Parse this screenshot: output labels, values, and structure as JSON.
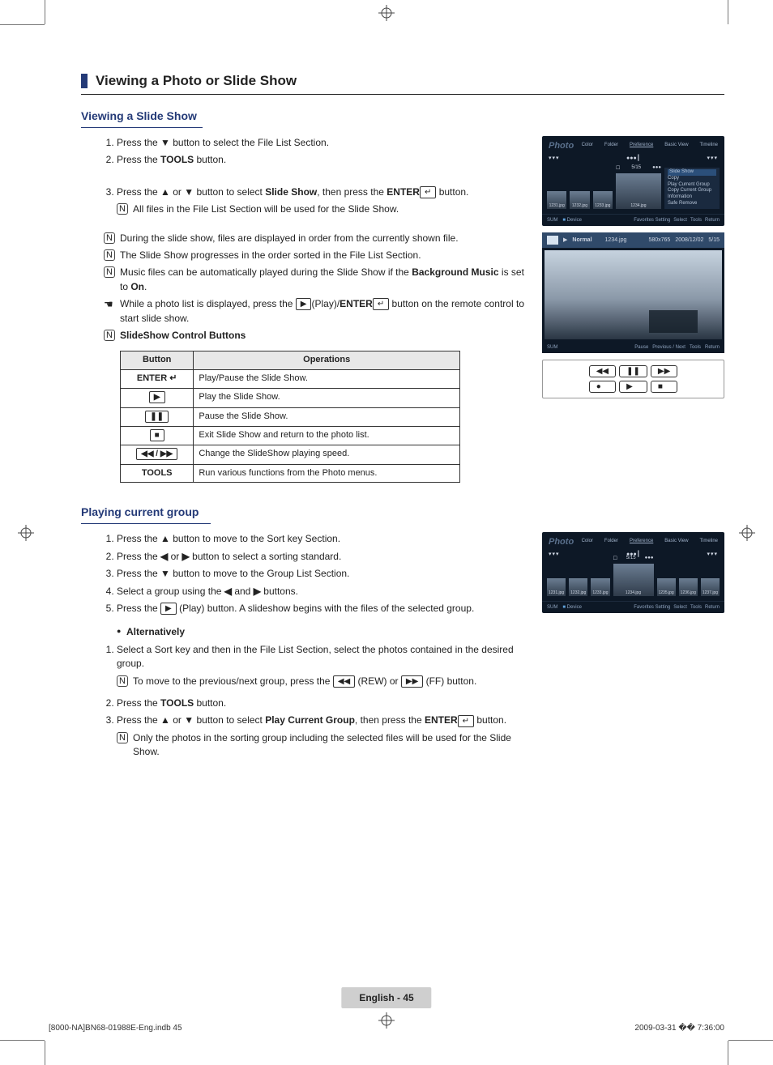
{
  "heading": "Viewing a Photo or Slide Show",
  "section1": {
    "title": "Viewing a Slide Show",
    "step1_pre": "Press the ",
    "step1_btn": "▼",
    "step1_post": " button to select the File List Section.",
    "step2_pre": "Press the ",
    "step2_bold": "TOOLS",
    "step2_post": " button.",
    "step3_pre": "Press the ",
    "step3_btn1": "▲",
    "step3_mid1": " or ",
    "step3_btn2": "▼",
    "step3_mid2": " button to select ",
    "step3_bold1": "Slide Show",
    "step3_mid3": ", then press the ",
    "step3_bold2": "ENTER",
    "step3_icon": "↵",
    "step3_post": " button.",
    "step3_note": "All files in the File List Section will be used for the Slide Show.",
    "note1": "During the slide show, files are displayed in order from the currently shown file.",
    "note2": "The Slide Show progresses in the order sorted in the File List Section.",
    "note3_pre": "Music files can be automatically played during the Slide Show if the ",
    "note3_bold1": "Background Music",
    "note3_mid": " is set to ",
    "note3_bold2": "On",
    "note3_post": ".",
    "note4_pre": "While a photo list is displayed, press the ",
    "note4_btn": "▶",
    "note4_mid1": "(Play)/",
    "note4_bold": "ENTER",
    "note4_icon": "↵",
    "note4_post": " button on the remote control to start slide show.",
    "note5": "SlideShow Control Buttons"
  },
  "table": {
    "h1": "Button",
    "h2": "Operations",
    "rows": [
      {
        "btn": "ENTER ↵",
        "btn_bold": true,
        "op": "Play/Pause the Slide Show."
      },
      {
        "btn": "▶",
        "op": "Play the Slide Show."
      },
      {
        "btn": "❚❚",
        "op": "Pause the Slide Show."
      },
      {
        "btn": "■",
        "op": "Exit Slide Show and return to the photo list."
      },
      {
        "btn": "◀◀ / ▶▶",
        "op": "Change the SlideShow playing speed."
      },
      {
        "btn": "TOOLS",
        "btn_bold": true,
        "op": "Run various functions from the Photo menus."
      }
    ]
  },
  "section2": {
    "title": "Playing current group",
    "step1_pre": "Press the ",
    "step1_btn": "▲",
    "step1_post": " button to move to the Sort key Section.",
    "step2_pre": "Press the ",
    "step2_btn1": "◀",
    "step2_mid": " or ",
    "step2_btn2": "▶",
    "step2_post": " button to select a sorting standard.",
    "step3_pre": "Press the ",
    "step3_btn": "▼",
    "step3_post": " button to move to the Group List Section.",
    "step4_pre": "Select a group using the ",
    "step4_btn1": "◀",
    "step4_mid": " and ",
    "step4_btn2": "▶",
    "step4_post": " buttons.",
    "step5_pre": "Press the ",
    "step5_btn": "▶",
    "step5_post": " (Play) button. A slideshow begins with the files of the selected group.",
    "alt_title": "Alternatively",
    "alt1": "Select a Sort key and then in the File List Section, select the photos contained in the desired group.",
    "alt1_note_pre": "To move to the previous/next group, press the ",
    "alt1_note_btn1": "◀◀",
    "alt1_note_mid1": " (REW) or ",
    "alt1_note_btn2": "▶▶",
    "alt1_note_post": " (FF) button.",
    "alt2_pre": "Press the ",
    "alt2_bold": "TOOLS",
    "alt2_post": " button.",
    "alt3_pre": "Press the ",
    "alt3_btn1": "▲",
    "alt3_mid1": " or ",
    "alt3_btn2": "▼",
    "alt3_mid2": " button to select ",
    "alt3_bold1": "Play Current Group",
    "alt3_mid3": ", then press the ",
    "alt3_bold2": "ENTER",
    "alt3_icon": "↵",
    "alt3_post": " button.",
    "alt3_note": "Only the photos in the sorting group including the selected files will be used for the Slide Show."
  },
  "panel1": {
    "title": "Photo",
    "tabs": [
      "Color",
      "Folder",
      "Preference",
      "Basic View",
      "Timeline"
    ],
    "counter": "5/15",
    "thumbs": [
      "1231.jpg",
      "1232.jpg",
      "1233.jpg",
      "1234.jpg"
    ],
    "menu": [
      "Slide Show",
      "Copy",
      "Play Current Group",
      "Copy Current Group",
      "Information",
      "Safe Remove"
    ],
    "foot_left": [
      "SUM",
      "Device"
    ],
    "foot_right": [
      "Favorites Setting",
      "Select",
      "Tools",
      "Return"
    ]
  },
  "panel2": {
    "mode": "Normal",
    "file": "1234.jpg",
    "res": "580x765",
    "date": "2008/12/02",
    "idx": "5/15",
    "foot_left": "SUM",
    "foot_right": [
      "Pause",
      "Previous / Next",
      "Tools",
      "Return"
    ]
  },
  "remote": {
    "b1": "◀◀",
    "b2": "❚❚",
    "b3": "▶▶",
    "b4": "●",
    "b5": "▶",
    "b6": "■"
  },
  "panel3": {
    "title": "Photo",
    "tabs": [
      "Color",
      "Folder",
      "Preference",
      "Basic View",
      "Timeline"
    ],
    "counter": "5/15",
    "thumbs": [
      "1231.jpg",
      "1232.jpg",
      "1233.jpg",
      "1234.jpg",
      "1235.jpg",
      "1236.jpg",
      "1237.jpg"
    ],
    "foot_left": [
      "SUM",
      "Device"
    ],
    "foot_right": [
      "Favorites Setting",
      "Select",
      "Tools",
      "Return"
    ]
  },
  "footer": "English - 45",
  "meta_left": "[8000-NA]BN68-01988E-Eng.indb   45",
  "meta_right": "2009-03-31   �� 7:36:00",
  "note_glyph": "N"
}
